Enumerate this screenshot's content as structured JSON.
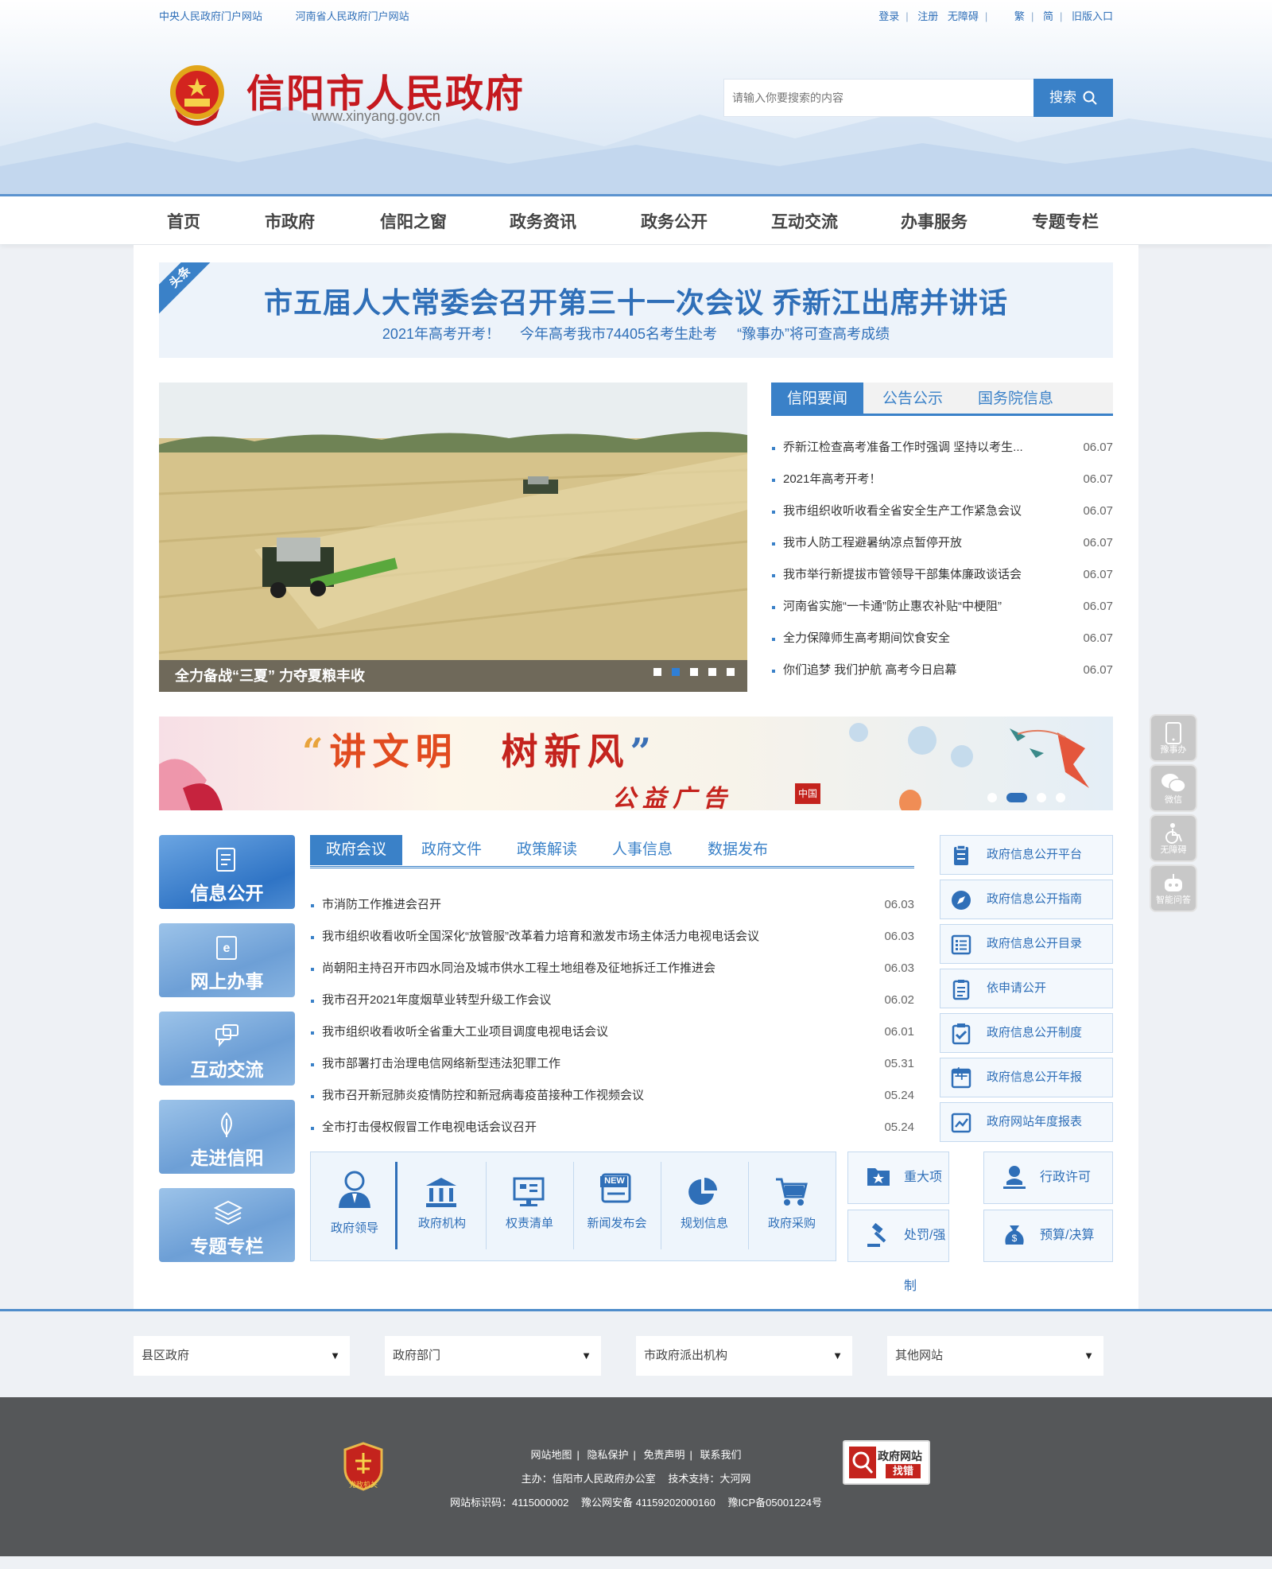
{
  "topbar": {
    "left_links": [
      "中央人民政府门户网站",
      "河南省人民政府门户网站"
    ],
    "right_links": [
      "登录",
      "注册",
      "无障碍",
      "繁",
      "简",
      "旧版入口"
    ]
  },
  "header": {
    "title": "信阳市人民政府",
    "url": "www.xinyang.gov.cn",
    "search_placeholder": "请输入你要搜索的内容",
    "search_button": "搜索"
  },
  "nav": [
    "首页",
    "市政府",
    "信阳之窗",
    "政务资讯",
    "政务公开",
    "互动交流",
    "办事服务",
    "专题专栏"
  ],
  "headline": {
    "tag": "头条",
    "title": "市五届人大常委会召开第三十一次会议 乔新江出席并讲话",
    "subs": [
      "2021年高考开考！",
      "今年高考我市74405名考生赴考",
      "“豫事办”将可查高考成绩"
    ]
  },
  "slideshow": {
    "caption": "全力备战“三夏” 力夺夏粮丰收",
    "count": 5,
    "active_index": 1
  },
  "news_tabs": [
    "信阳要闻",
    "公告公示",
    "国务院信息"
  ],
  "news_list": [
    {
      "title": "乔新江检查高考准备工作时强调 坚持以考生...",
      "date": "06.07"
    },
    {
      "title": "2021年高考开考！",
      "date": "06.07"
    },
    {
      "title": "我市组织收听收看全省安全生产工作紧急会议",
      "date": "06.07"
    },
    {
      "title": "我市人防工程避暑纳凉点暂停开放",
      "date": "06.07"
    },
    {
      "title": "我市举行新提拔市管领导干部集体廉政谈话会",
      "date": "06.07"
    },
    {
      "title": "河南省实施“一卡通”防止惠农补贴“中梗阻”",
      "date": "06.07"
    },
    {
      "title": "全力保障师生高考期间饮食安全",
      "date": "06.07"
    },
    {
      "title": "你们追梦 我们护航 高考今日启幕",
      "date": "06.07"
    }
  ],
  "banner": {
    "quote_open": "“",
    "part1": "讲文明",
    "part2": "树新风",
    "quote_close": "”",
    "sub": "公益广告",
    "stamp": "中国",
    "count": 4,
    "active_index": 1
  },
  "tiles": [
    "信息公开",
    "网上办事",
    "互动交流",
    "走进信阳",
    "专题专栏"
  ],
  "gov_tabs": [
    "政府会议",
    "政府文件",
    "政策解读",
    "人事信息",
    "数据发布"
  ],
  "gov_list": [
    {
      "title": "市消防工作推进会召开",
      "date": "06.03"
    },
    {
      "title": "我市组织收看收听全国深化“放管服”改革着力培育和激发市场主体活力电视电话会议",
      "date": "06.03"
    },
    {
      "title": "尚朝阳主持召开市四水同治及城市供水工程土地组卷及征地拆迁工作推进会",
      "date": "06.03"
    },
    {
      "title": "我市召开2021年度烟草业转型升级工作会议",
      "date": "06.02"
    },
    {
      "title": "我市组织收看收听全省重大工业项目调度电视电话会议",
      "date": "06.01"
    },
    {
      "title": "我市部署打击治理电信网络新型违法犯罪工作",
      "date": "05.31"
    },
    {
      "title": "我市召开新冠肺炎疫情防控和新冠病毒疫苗接种工作视频会议",
      "date": "05.24"
    },
    {
      "title": "全市打击侵权假冒工作电视电话会议召开",
      "date": "05.24"
    }
  ],
  "quick_links": [
    "政府领导",
    "政府机构",
    "权责清单",
    "新闻发布会",
    "规划信息",
    "政府采购"
  ],
  "quick_new_badge": "NEW",
  "info_links": [
    "政府信息公开平台",
    "政府信息公开指南",
    "政府信息公开目录",
    "依申请公开",
    "政府信息公开制度",
    "政府信息公开年报",
    "政府网站年度报表"
  ],
  "info_year_glyph": "年",
  "service_buttons": [
    "重大项目",
    "行政许可",
    "处罚/强制",
    "预算/决算"
  ],
  "float_bar": [
    "豫事办",
    "微信",
    "无障碍",
    "智能问答"
  ],
  "selects": [
    "县区政府",
    "政府部门",
    "市政府派出机构",
    "其他网站"
  ],
  "footer": {
    "links": [
      "网站地图",
      "隐私保护",
      "免责声明",
      "联系我们"
    ],
    "host": "主办：信阳市人民政府办公室",
    "tech": "技术支持：大河网",
    "site_id": "网站标识码：4115000002",
    "police": "豫公网安备 41159202000160",
    "icp": "豫ICP备05001224号",
    "badge_left": "党政机关",
    "badge_right_1": "政府网站",
    "badge_right_2": "找错"
  },
  "colors": {
    "primary": "#3a81c8",
    "title_red": "#c5191f",
    "footer_bg": "#555759"
  }
}
